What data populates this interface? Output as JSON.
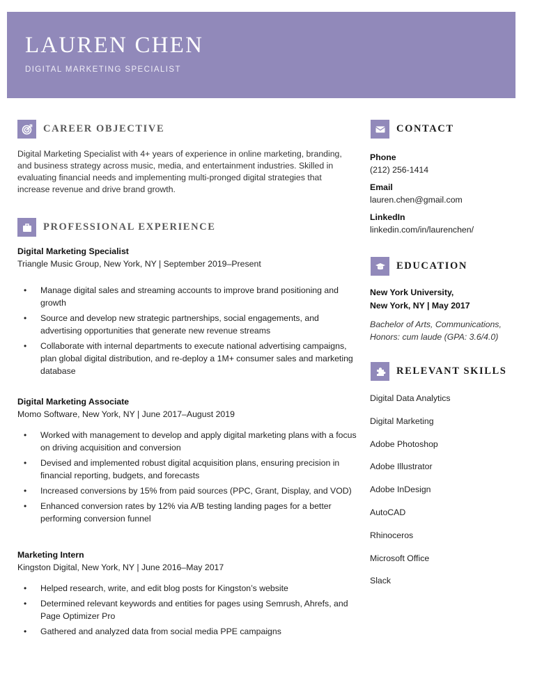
{
  "header": {
    "name": "LAUREN CHEN",
    "title": "DIGITAL MARKETING SPECIALIST",
    "accent_color": "#9189ba"
  },
  "career_objective": {
    "heading": "CAREER OBJECTIVE",
    "icon": "target-icon",
    "text": "Digital Marketing Specialist with 4+ years of experience in online marketing, branding, and business strategy across music, media, and entertainment industries. Skilled in evaluating financial needs and implementing multi-pronged digital strategies that increase revenue and drive brand growth."
  },
  "experience": {
    "heading": "PROFESSIONAL EXPERIENCE",
    "icon": "briefcase-icon",
    "jobs": [
      {
        "title": "Digital Marketing Specialist",
        "meta": "Triangle Music Group, New York, NY | September 2019–Present",
        "bullets": [
          "Manage digital sales and streaming accounts to improve brand positioning and growth",
          "Source and develop new strategic partnerships, social engagements, and advertising opportunities that generate new revenue streams",
          "Collaborate with internal departments to execute national advertising campaigns, plan global digital distribution, and re-deploy a 1M+ consumer sales and marketing database"
        ]
      },
      {
        "title": "Digital Marketing Associate",
        "meta": "Momo Software, New York, NY | June 2017–August 2019",
        "bullets": [
          "Worked with management to develop and apply digital marketing plans with a focus on driving acquisition and conversion",
          "Devised and implemented robust digital acquisition plans, ensuring precision in financial reporting, budgets, and forecasts",
          "Increased conversions by 15% from paid sources (PPC, Grant, Display, and VOD)",
          "Enhanced conversion rates by 12% via A/B testing landing pages for a better performing conversion funnel"
        ]
      },
      {
        "title": "Marketing Intern",
        "meta": "Kingston Digital, New York, NY | June 2016–May 2017",
        "bullets": [
          "Helped research, write, and edit blog posts for Kingston’s website",
          "Determined relevant keywords and entities for pages using Semrush, Ahrefs, and Page Optimizer Pro",
          "Gathered and analyzed data from social media PPE campaigns"
        ]
      }
    ]
  },
  "contact": {
    "heading": "CONTACT",
    "icon": "envelope-icon",
    "phone_label": "Phone",
    "phone": "(212) 256-1414",
    "email_label": "Email",
    "email": "lauren.chen@gmail.com",
    "linkedin_label": "LinkedIn",
    "linkedin": "linkedin.com/in/laurenchen/"
  },
  "education": {
    "heading": "EDUCATION",
    "icon": "graduation-cap-icon",
    "school_line1": "New York University,",
    "school_line2": "New York, NY | May 2017",
    "degree_line1": "Bachelor of Arts, Communications,",
    "degree_line2": "Honors: cum laude (GPA: 3.6/4.0)"
  },
  "skills": {
    "heading": "RELEVANT SKILLS",
    "icon": "puzzle-icon",
    "items": [
      "Digital Data Analytics",
      "Digital Marketing",
      "Adobe Photoshop",
      "Adobe Illustrator",
      "Adobe InDesign",
      "AutoCAD",
      "Rhinoceros",
      "Microsoft Office",
      "Slack"
    ]
  }
}
